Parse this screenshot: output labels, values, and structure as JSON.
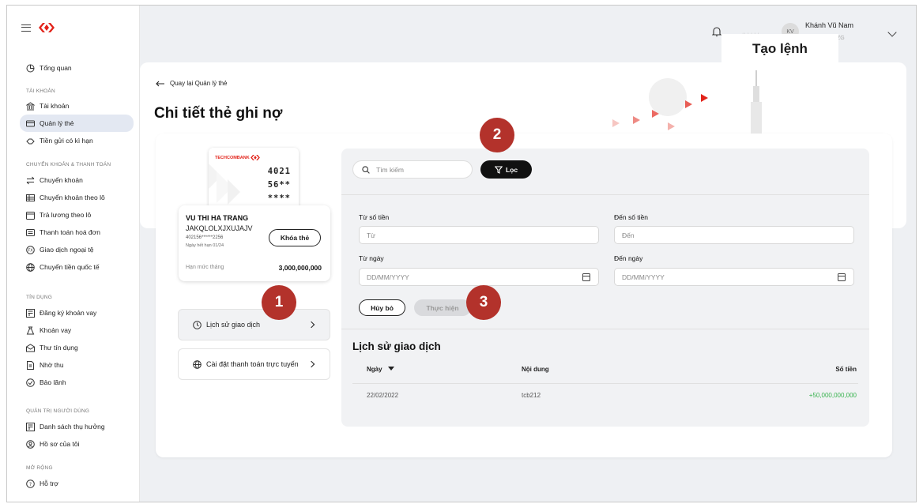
{
  "sidebar": {
    "items": [
      {
        "label": "Tổng quan",
        "icon": "pie-icon"
      },
      {
        "label": "Tài khoản",
        "icon": "bank-icon"
      },
      {
        "label": "Quản lý thẻ",
        "icon": "card-icon",
        "active": true
      },
      {
        "label": "Tiền gửi có kì hạn",
        "icon": "deposit-icon"
      },
      {
        "label": "Chuyển khoản",
        "icon": "transfer-icon"
      },
      {
        "label": "Chuyển khoản theo lô",
        "icon": "batch-icon"
      },
      {
        "label": "Trả lương theo lô",
        "icon": "calendar-icon"
      },
      {
        "label": "Thanh toán hoá đơn",
        "icon": "bill-icon"
      },
      {
        "label": "Giao dịch ngoại tệ",
        "icon": "fx-icon"
      },
      {
        "label": "Chuyển tiền quốc tế",
        "icon": "globe-icon"
      },
      {
        "label": "Đăng ký khoản vay",
        "icon": "loan-register-icon"
      },
      {
        "label": "Khoản vay",
        "icon": "loan-icon"
      },
      {
        "label": "Thư tín dụng",
        "icon": "letter-icon"
      },
      {
        "label": "Nhờ thu",
        "icon": "collection-icon"
      },
      {
        "label": "Bảo lãnh",
        "icon": "guarantee-icon"
      },
      {
        "label": "Danh sách thụ hưởng",
        "icon": "beneficiary-icon"
      },
      {
        "label": "Hồ sơ của tôi",
        "icon": "profile-icon"
      },
      {
        "label": "Hỗ trợ",
        "icon": "help-icon"
      }
    ],
    "sections": {
      "accounts": "TÀI KHOẢN",
      "transfers": "CHUYỂN KHOẢN & THANH TOÁN",
      "credit": "TÍN DỤNG",
      "users": "QUẢN TRỊ NGƯỜI DÙNG",
      "extend": "MỞ RỘNG"
    }
  },
  "topbar": {
    "user_name": "Khánh Vũ Nam",
    "avatar_initials": "KV",
    "user_sub": "ZG",
    "blurred_text": "·· · · · ·",
    "overlay_label": "Tạo lệnh"
  },
  "header": {
    "back_label": "Quay lại Quản lý thẻ",
    "title": "Chi tiết thẻ ghi nợ"
  },
  "card": {
    "brand": "TECHCOMBANK",
    "number_lines": [
      "4021",
      "56**",
      "****"
    ],
    "holder": "VU THI HA TRANG",
    "code": "JAKQLOLXJXUJAJV",
    "masked": "402156******2256",
    "expiry": "Ngày hết hạn 01/24",
    "lock_label": "Khóa thẻ",
    "limit_label": "Hạn mức tháng",
    "limit_value": "3,000,000,000"
  },
  "nav": {
    "history_label": "Lịch sử giao dịch",
    "online_label": "Cài đặt thanh toán trực tuyến"
  },
  "filter": {
    "search_placeholder": "Tìm kiếm",
    "filter_label": "Lọc",
    "amount_from_label": "Từ số tiền",
    "amount_from_placeholder": "Từ",
    "amount_to_label": "Đến số tiền",
    "amount_to_placeholder": "Đến",
    "date_from_label": "Từ ngày",
    "date_from_placeholder": "DD/MM/YYYY",
    "date_to_label": "Đến ngày",
    "date_to_placeholder": "DD/MM/YYYY",
    "cancel_label": "Hủy bỏ",
    "execute_label": "Thực hiện"
  },
  "history": {
    "title": "Lịch sử giao dịch",
    "columns": [
      "Ngày",
      "Nội dung",
      "Số tiền"
    ],
    "rows": [
      {
        "date": "22/02/2022",
        "content": "tcb212",
        "amount": "+50,000,000,000"
      }
    ]
  },
  "steps": [
    "1",
    "2",
    "3"
  ],
  "colors": {
    "brand_red": "#e2231a",
    "step_red": "#b3322b",
    "positive_green": "#37b24d",
    "active_bg": "#e3e8f2"
  }
}
